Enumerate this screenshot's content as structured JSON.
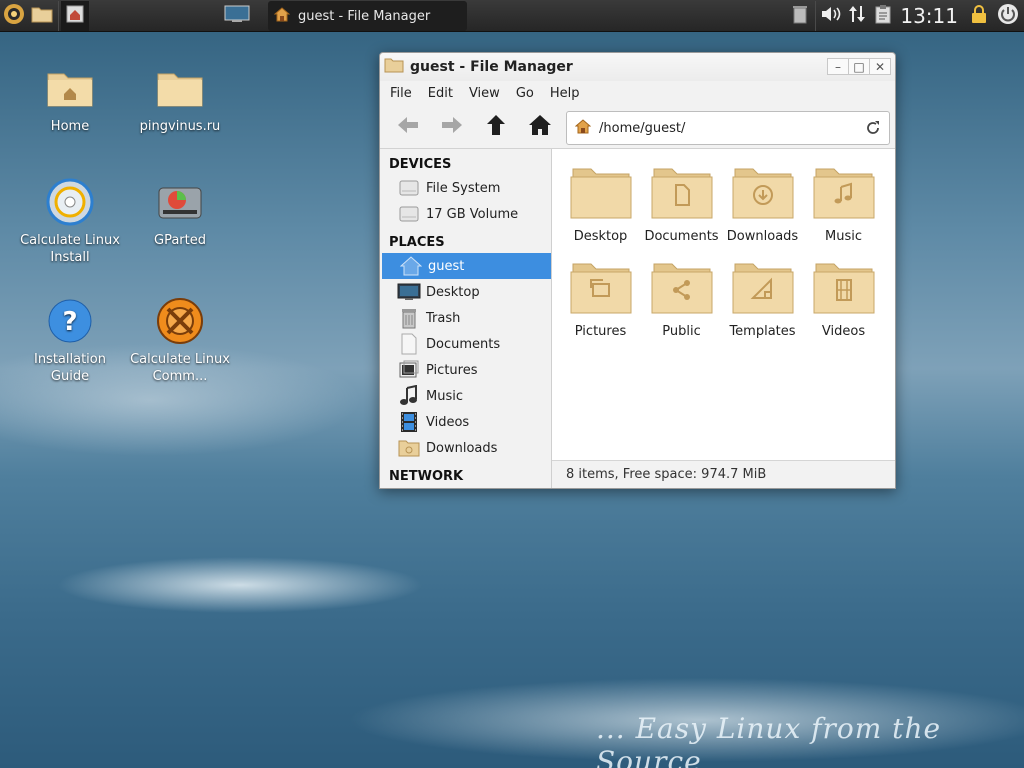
{
  "panel": {
    "task_title": "guest - File Manager",
    "clock": "13:11"
  },
  "desktop": {
    "icons": [
      {
        "label": "Home"
      },
      {
        "label": "pingvinus.ru"
      },
      {
        "label": "Calculate Linux Install"
      },
      {
        "label": "GParted"
      },
      {
        "label": "Installation Guide"
      },
      {
        "label": "Calculate Linux Comm..."
      }
    ],
    "tagline": "... Easy Linux from the Source"
  },
  "window": {
    "title": "guest - File Manager",
    "menu": [
      "File",
      "Edit",
      "View",
      "Go",
      "Help"
    ],
    "location": "/home/guest/",
    "sidebar": {
      "devices_header": "DEVICES",
      "devices": [
        {
          "label": "File System",
          "icon": "drive-icon"
        },
        {
          "label": "17 GB Volume",
          "icon": "drive-icon"
        }
      ],
      "places_header": "PLACES",
      "places": [
        {
          "label": "guest",
          "icon": "home-icon",
          "selected": true
        },
        {
          "label": "Desktop",
          "icon": "desktop-icon"
        },
        {
          "label": "Trash",
          "icon": "trash-icon"
        },
        {
          "label": "Documents",
          "icon": "document-icon"
        },
        {
          "label": "Pictures",
          "icon": "pictures-icon"
        },
        {
          "label": "Music",
          "icon": "music-icon"
        },
        {
          "label": "Videos",
          "icon": "videos-icon"
        },
        {
          "label": "Downloads",
          "icon": "downloads-icon"
        }
      ],
      "network_header": "NETWORK"
    },
    "files": [
      {
        "label": "Desktop",
        "icon": "folder-icon"
      },
      {
        "label": "Documents",
        "icon": "folder-documents-icon"
      },
      {
        "label": "Downloads",
        "icon": "folder-downloads-icon"
      },
      {
        "label": "Music",
        "icon": "folder-music-icon"
      },
      {
        "label": "Pictures",
        "icon": "folder-pictures-icon"
      },
      {
        "label": "Public",
        "icon": "folder-public-icon"
      },
      {
        "label": "Templates",
        "icon": "folder-templates-icon"
      },
      {
        "label": "Videos",
        "icon": "folder-videos-icon"
      }
    ],
    "status": "8 items, Free space: 974.7 MiB"
  },
  "colors": {
    "selection": "#3d8ee0",
    "folder": "#e9cf9a",
    "panel": "#2e2e2e"
  }
}
